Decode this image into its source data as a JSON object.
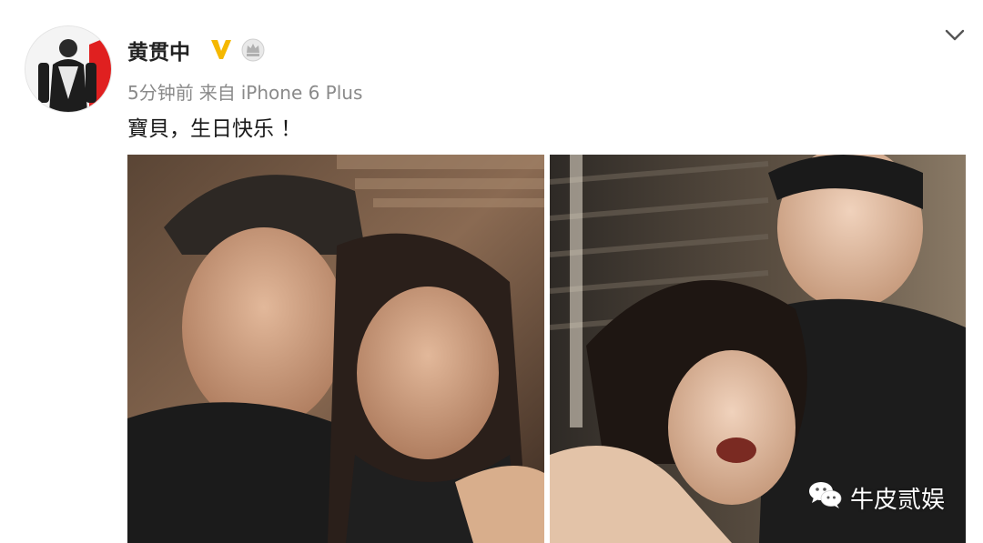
{
  "post": {
    "username": "黄贯中",
    "timestamp": "5分钟前",
    "source_prefix": "来自",
    "device": "iPhone 6 Plus",
    "text": "寶貝，生日快乐 ！"
  },
  "icons": {
    "avatar": "user-avatar",
    "verified": "verified-v-icon",
    "member": "member-crown-icon",
    "menu": "chevron-down-icon",
    "watermark": "wechat-icon"
  },
  "watermark": {
    "text": "牛皮贰娱"
  },
  "colors": {
    "verified": "#f5b800",
    "meta_text": "#8a8a8a",
    "avatar_red": "#e02020"
  }
}
